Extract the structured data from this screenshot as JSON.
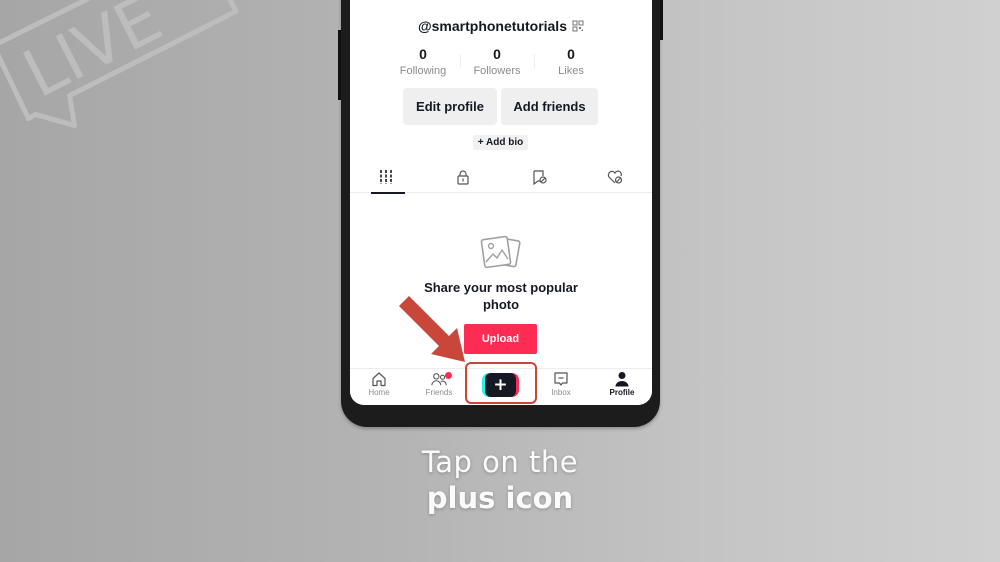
{
  "watermark": {
    "text": "LIVE"
  },
  "profile": {
    "username": "@smartphonetutorials",
    "stats": [
      {
        "value": "0",
        "label": "Following"
      },
      {
        "value": "0",
        "label": "Followers"
      },
      {
        "value": "0",
        "label": "Likes"
      }
    ],
    "edit_profile_label": "Edit profile",
    "add_friends_label": "Add friends",
    "add_bio_label": "+ Add bio"
  },
  "tabs": [
    {
      "icon": "videos-grid-icon",
      "active": true
    },
    {
      "icon": "private-lock-icon",
      "active": false
    },
    {
      "icon": "reposts-icon",
      "active": false
    },
    {
      "icon": "liked-heart-icon",
      "active": false
    }
  ],
  "empty_state": {
    "icon": "photo-icon",
    "title": "Share your most popular photo",
    "button_label": "Upload"
  },
  "bottom_nav": {
    "items": [
      {
        "label": "Home",
        "icon": "home-icon"
      },
      {
        "label": "Friends",
        "icon": "friends-icon",
        "badge": true
      },
      {
        "label": "",
        "icon": "plus-icon"
      },
      {
        "label": "Inbox",
        "icon": "inbox-icon"
      },
      {
        "label": "Profile",
        "icon": "profile-icon",
        "active": true
      }
    ],
    "create_symbol": "+"
  },
  "colors": {
    "accent": "#fe2c55",
    "cyan": "#25f4ee",
    "annotation": "#c9463b",
    "text_primary": "#161823",
    "text_secondary": "#8a8b91"
  },
  "caption": {
    "line1": "Tap on the",
    "line2": "plus icon"
  }
}
